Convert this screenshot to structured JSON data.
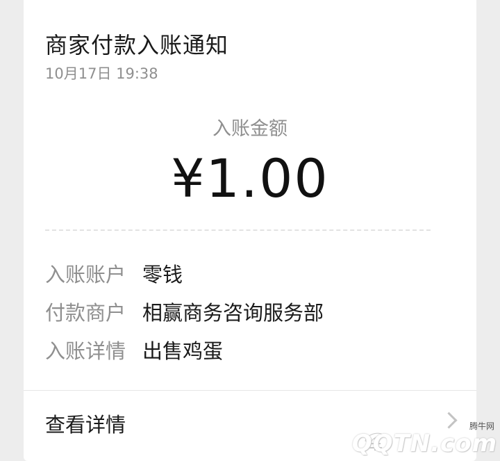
{
  "notification": {
    "title": "商家付款入账通知",
    "time": "10月17日  19:38",
    "amount_label": "入账金额",
    "amount": "¥1.00",
    "details": [
      {
        "label": "入账账户",
        "value": "零钱"
      },
      {
        "label": "付款商户",
        "value": "相赢商务咨询服务部"
      },
      {
        "label": "入账详情",
        "value": "出售鸡蛋"
      }
    ],
    "detail_link": "查看详情"
  },
  "watermark": {
    "site_small": "腾牛网",
    "site_main": "QQTN.com"
  }
}
